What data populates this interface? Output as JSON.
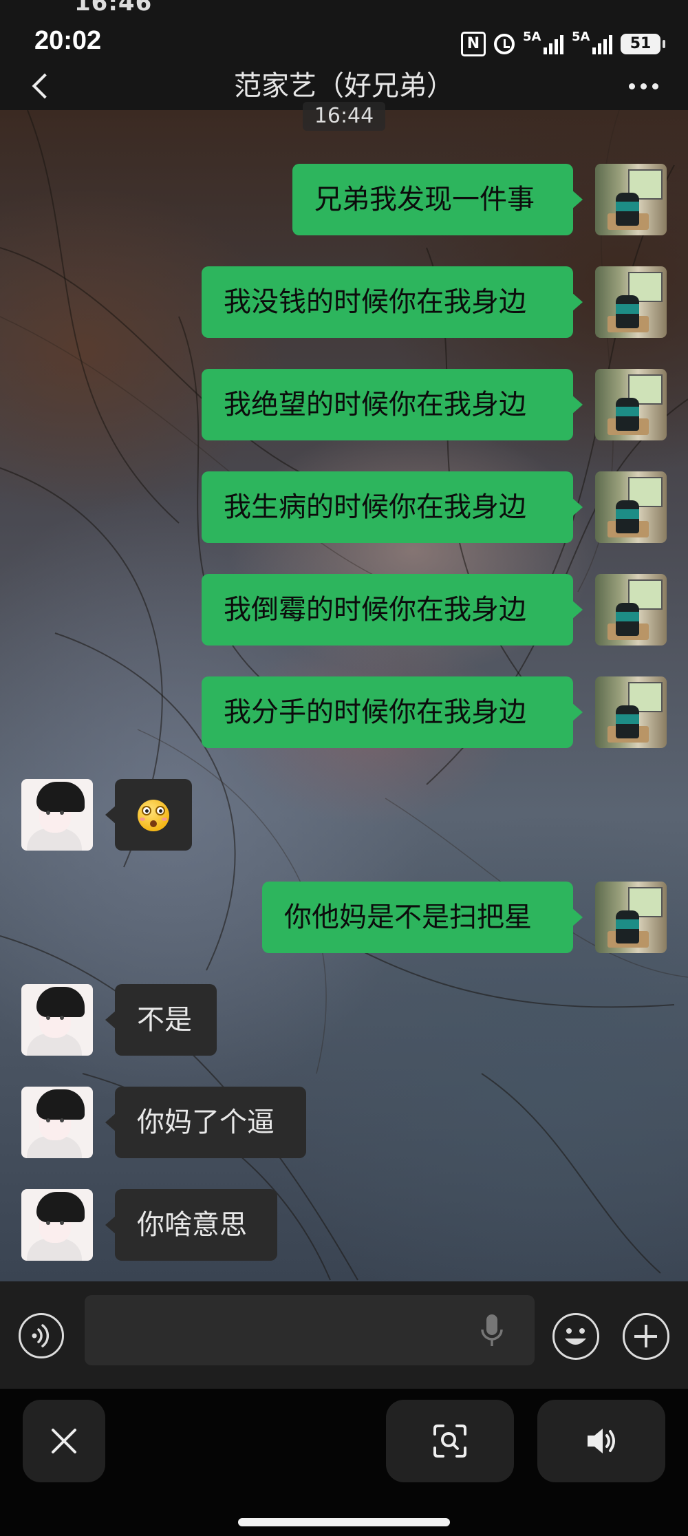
{
  "status_bar": {
    "ghost_time": "16:46",
    "time": "20:02",
    "nfc_label": "N",
    "signal1_label": "5A",
    "signal2_label": "5A",
    "battery": "51"
  },
  "header": {
    "title": "范家艺（好兄弟）",
    "back_icon": "chevron-left-icon",
    "more_icon": "more-dots-icon"
  },
  "chat": {
    "timestamp": "16:44",
    "messages": [
      {
        "side": "me",
        "text": "兄弟我发现一件事"
      },
      {
        "side": "me",
        "text": "我没钱的时候你在我身边"
      },
      {
        "side": "me",
        "text": "我绝望的时候你在我身边"
      },
      {
        "side": "me",
        "text": "我生病的时候你在我身边"
      },
      {
        "side": "me",
        "text": "我倒霉的时候你在我身边"
      },
      {
        "side": "me",
        "text": "我分手的时候你在我身边"
      },
      {
        "side": "friend",
        "text": "",
        "emoji": "flushed-face-emoji"
      },
      {
        "side": "me",
        "text": "你他妈是不是扫把星"
      },
      {
        "side": "friend",
        "text": "不是"
      },
      {
        "side": "friend",
        "text": "你妈了个逼"
      },
      {
        "side": "friend",
        "text": "你啥意思"
      }
    ]
  },
  "input_bar": {
    "message_value": "",
    "voice_icon": "voice-input-icon",
    "mic_icon": "microphone-icon",
    "emoji_icon": "smiley-icon",
    "plus_icon": "plus-icon"
  },
  "bottom_tray": {
    "close_icon": "close-icon",
    "scan_icon": "scan-search-icon",
    "sound_icon": "speaker-icon"
  },
  "colors": {
    "bubble_me": "#2db55d",
    "bubble_friend": "#2b2b2b",
    "bar_bg": "#161616"
  }
}
